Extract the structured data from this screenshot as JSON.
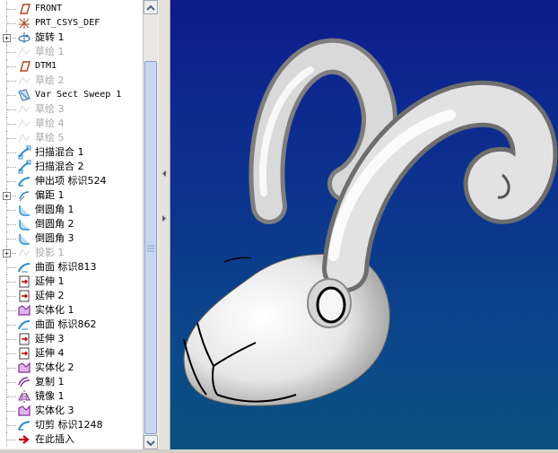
{
  "model_tree": {
    "items": [
      {
        "label": "FRONT",
        "icon": "datum-plane-icon",
        "expand": "",
        "dim": false,
        "mono": true
      },
      {
        "label": "PRT_CSYS_DEF",
        "icon": "coordinate-system-icon",
        "expand": "",
        "dim": false,
        "mono": true
      },
      {
        "label": "旋转 1",
        "icon": "revolve-icon",
        "expand": "+",
        "dim": false,
        "mono": false
      },
      {
        "label": "草绘 1",
        "icon": "sketch-icon",
        "expand": "",
        "dim": true,
        "mono": false
      },
      {
        "label": "DTM1",
        "icon": "datum-plane-icon",
        "expand": "",
        "dim": false,
        "mono": true
      },
      {
        "label": "草绘 2",
        "icon": "sketch-icon",
        "expand": "",
        "dim": true,
        "mono": false
      },
      {
        "label": "Var Sect Sweep 1",
        "icon": "var-sect-sweep-icon",
        "expand": "",
        "dim": false,
        "mono": true
      },
      {
        "label": "草绘 3",
        "icon": "sketch-icon",
        "expand": "",
        "dim": true,
        "mono": false
      },
      {
        "label": "草绘 4",
        "icon": "sketch-icon",
        "expand": "",
        "dim": true,
        "mono": false
      },
      {
        "label": "草绘 5",
        "icon": "sketch-icon",
        "expand": "",
        "dim": true,
        "mono": false
      },
      {
        "label": "扫描混合 1",
        "icon": "swept-blend-icon",
        "expand": "",
        "dim": false,
        "mono": false
      },
      {
        "label": "扫描混合 2",
        "icon": "swept-blend-icon",
        "expand": "",
        "dim": false,
        "mono": false
      },
      {
        "label": "伸出项 标识524",
        "icon": "protrusion-icon",
        "expand": "",
        "dim": false,
        "mono": false
      },
      {
        "label": "偏距 1",
        "icon": "offset-icon",
        "expand": "+",
        "dim": false,
        "mono": false
      },
      {
        "label": "倒圆角 1",
        "icon": "round-icon",
        "expand": "",
        "dim": false,
        "mono": false
      },
      {
        "label": "倒圆角 2",
        "icon": "round-icon",
        "expand": "",
        "dim": false,
        "mono": false
      },
      {
        "label": "倒圆角 3",
        "icon": "round-icon",
        "expand": "",
        "dim": false,
        "mono": false
      },
      {
        "label": "投影 1",
        "icon": "project-icon",
        "expand": "+",
        "dim": true,
        "mono": false
      },
      {
        "label": "曲面 标识813",
        "icon": "surface-icon",
        "expand": "",
        "dim": false,
        "mono": false
      },
      {
        "label": "延伸 1",
        "icon": "extend-icon",
        "expand": "",
        "dim": false,
        "mono": false
      },
      {
        "label": "延伸 2",
        "icon": "extend-icon",
        "expand": "",
        "dim": false,
        "mono": false
      },
      {
        "label": "实体化 1",
        "icon": "solidify-icon",
        "expand": "",
        "dim": false,
        "mono": false
      },
      {
        "label": "曲面 标识862",
        "icon": "surface-icon",
        "expand": "",
        "dim": false,
        "mono": false
      },
      {
        "label": "延伸 3",
        "icon": "extend-icon",
        "expand": "",
        "dim": false,
        "mono": false
      },
      {
        "label": "延伸 4",
        "icon": "extend-icon",
        "expand": "",
        "dim": false,
        "mono": false
      },
      {
        "label": "实体化 2",
        "icon": "solidify-icon",
        "expand": "",
        "dim": false,
        "mono": false
      },
      {
        "label": "复制 1",
        "icon": "copy-icon",
        "expand": "",
        "dim": false,
        "mono": false
      },
      {
        "label": "镜像 1",
        "icon": "mirror-icon",
        "expand": "",
        "dim": false,
        "mono": false
      },
      {
        "label": "实体化 3",
        "icon": "solidify-icon",
        "expand": "",
        "dim": false,
        "mono": false
      },
      {
        "label": "切剪 标识1248",
        "icon": "cut-icon",
        "expand": "",
        "dim": false,
        "mono": false
      },
      {
        "label": "在此插入",
        "icon": "insert-here-arrow-icon",
        "expand": "",
        "dim": false,
        "mono": false
      }
    ]
  },
  "scrollbar": {
    "up_icon": "scroll-up-arrow-icon",
    "down_icon": "scroll-down-arrow-icon"
  },
  "splitter": {
    "collapse_icon": "collapse-left-arrow-icon",
    "expand_icon": "expand-right-arrow-icon"
  },
  "viewport": {
    "background_top": "#0e1b8c",
    "background_bottom": "#0a5080",
    "model_color": "#e8e8e8"
  }
}
